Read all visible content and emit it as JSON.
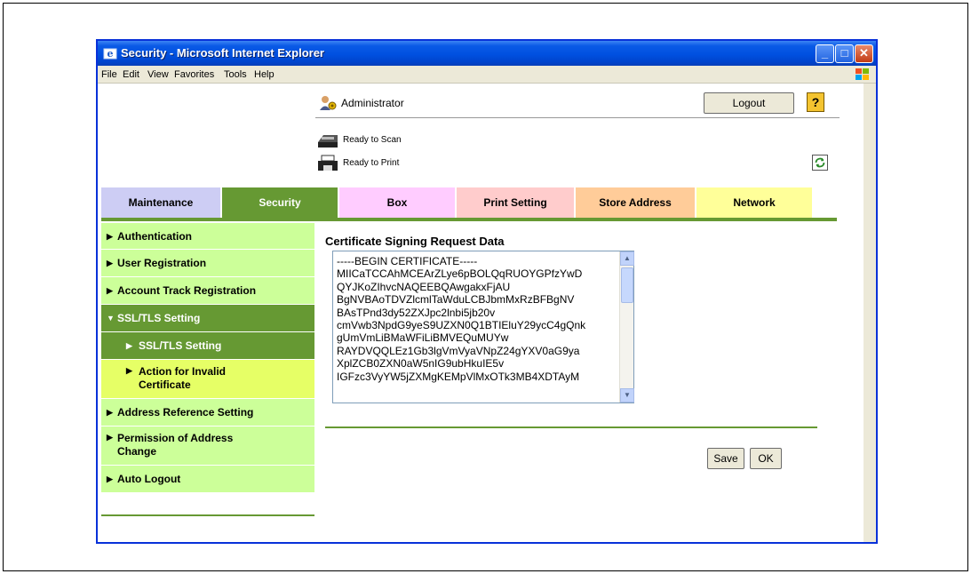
{
  "window": {
    "title": "Security - Microsoft Internet Explorer",
    "controls": {
      "minimize": "_",
      "maximize": "□",
      "close": "✕"
    }
  },
  "menu": [
    "File",
    "Edit",
    "View",
    "Favorites",
    "Tools",
    "Help"
  ],
  "header": {
    "user": "Administrator",
    "logout_label": "Logout",
    "help_label": "?",
    "scan_status": "Ready to Scan",
    "print_status": "Ready to Print"
  },
  "tabs": [
    "Maintenance",
    "Security",
    "Box",
    "Print Setting",
    "Store Address",
    "Network"
  ],
  "active_tab": "Security",
  "sidebar": {
    "items": [
      {
        "label": "Authentication",
        "arrow": "▶"
      },
      {
        "label": "User Registration",
        "arrow": "▶"
      },
      {
        "label": "Account Track Registration",
        "arrow": "▶"
      },
      {
        "label": "SSL/TLS Setting",
        "arrow": "▼"
      },
      {
        "label": "SSL/TLS Setting",
        "arrow": "▶"
      },
      {
        "label": "Action for Invalid Certificate",
        "arrow": "▶"
      },
      {
        "label": "Address Reference Setting",
        "arrow": "▶"
      },
      {
        "label": "Permission of Address Change",
        "arrow": "▶"
      },
      {
        "label": "Auto Logout",
        "arrow": "▶"
      }
    ]
  },
  "main": {
    "title": "Certificate Signing Request Data",
    "csr_lines": "-----BEGIN CERTIFICATE-----\nMIICaTCCAhMCEArZLye6pBOLQqRUOYGPfzYwD\nQYJKoZIhvcNAQEEBQAwgakxFjAU\nBgNVBAoTDVZlcmlTaWduLCBJbmMxRzBFBgNV\nBAsTPnd3dy52ZXJpc2lnbi5jb20v\ncmVwb3NpdG9yeS9UZXN0Q1BTIEluY29ycC4gQnk\ngUmVmLiBMaWFiLiBMVEQuMUYw\nRAYDVQQLEz1Gb3lgVmVyaVNpZ24gYXV0aG9ya\nXplZCB0ZXN0aW5nIG9ubHkuIE5v\nIGFzc3VyYW5jZXMgKEMpVlMxOTk3MB4XDTAyM",
    "save_label": "Save",
    "ok_label": "OK"
  },
  "colors": {
    "accent_green": "#669933",
    "light_green": "#ccff99",
    "xp_blue": "#0050e0"
  }
}
